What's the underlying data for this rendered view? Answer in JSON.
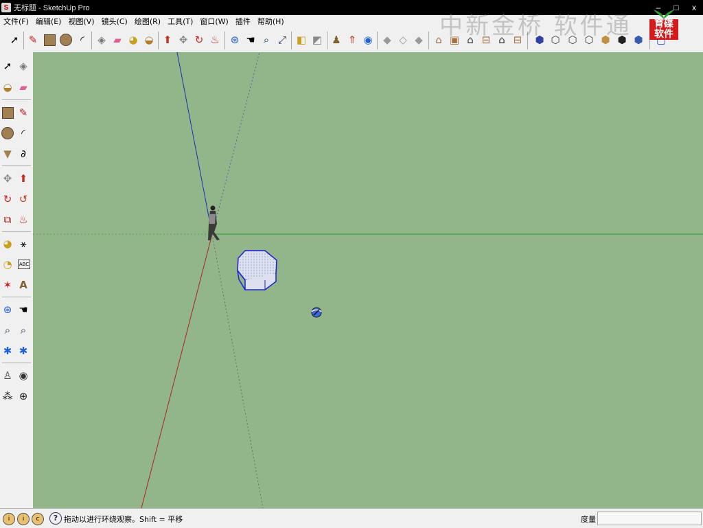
{
  "window": {
    "title": "无标题 - SketchUp Pro",
    "minimize_glyph": "–",
    "maximize_glyph": "□",
    "close_glyph": "x"
  },
  "menu": {
    "items": [
      "文件(F)",
      "编辑(E)",
      "视图(V)",
      "镜头(C)",
      "绘图(R)",
      "工具(T)",
      "窗口(W)",
      "插件",
      "帮助(H)"
    ]
  },
  "watermark": {
    "text": "中新金桥 软件通",
    "logo_text_1": "育碟",
    "logo_text_2": "软件"
  },
  "toolbar": {
    "icons": [
      "select-icon",
      "pencil-line-icon",
      "rectangle-icon",
      "circle-icon",
      "arc-icon",
      "make-component-icon",
      "eraser-icon",
      "tape-measure-icon",
      "paint-bucket-icon",
      "push-pull-icon",
      "move-icon",
      "rotate-icon",
      "follow-me-icon",
      "orbit-icon",
      "pan-icon",
      "zoom-icon",
      "zoom-extents-icon",
      "previous-view-icon",
      "next-view-icon",
      "position-camera-icon",
      "walk-icon",
      "look-around-icon",
      "section-plane-icon",
      "section-display-icon",
      "section-cuts-icon",
      "iso-view-icon",
      "top-view-icon",
      "front-view-icon",
      "right-view-icon",
      "back-view-icon",
      "left-view-icon",
      "xray-icon",
      "wireframe-icon",
      "hidden-line-icon",
      "shaded-icon",
      "shaded-textures-icon",
      "monochrome-icon",
      "display-mode-icon"
    ]
  },
  "left_toolbar": {
    "icons": [
      "select-icon",
      "make-component-icon",
      "paint-bucket-icon",
      "eraser-icon",
      "rectangle-icon",
      "pencil-line-icon",
      "circle-icon",
      "arc-icon",
      "polygon-icon",
      "freehand-icon",
      "move-icon",
      "push-pull-icon",
      "rotate-icon",
      "follow-me-icon",
      "scale-icon",
      "offset-icon",
      "tape-measure-icon",
      "dimension-icon",
      "protractor-icon",
      "text-icon",
      "axes-icon",
      "3d-text-icon",
      "orbit-icon",
      "pan-icon",
      "zoom-icon",
      "zoom-window-icon",
      "zoom-extents-icon",
      "previous-view-icon",
      "position-camera-icon",
      "look-around-icon",
      "walk-icon",
      "section-plane-icon"
    ],
    "abc_label": "ABC"
  },
  "viewport": {
    "background_color": "#93b58a",
    "axis_colors": {
      "blue": "#1a2fb0",
      "green": "#2a9a2a",
      "red": "#b02020"
    },
    "shape_fill": "#dde0ef",
    "shape_stroke": "#1a22d8"
  },
  "status_bar": {
    "help_glyph": "?",
    "message": "拖动以进行环绕观察。Shift = 平移",
    "measure_label": "度量",
    "measure_value": ""
  }
}
